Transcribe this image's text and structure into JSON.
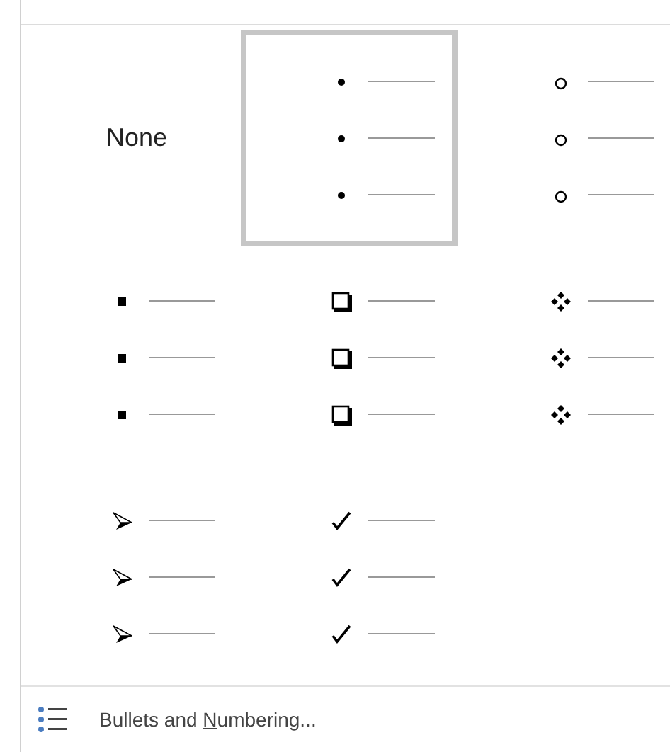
{
  "bullet_library": [
    {
      "kind": "none",
      "label": "None",
      "selected": false
    },
    {
      "kind": "disc",
      "selected": true
    },
    {
      "kind": "circle",
      "selected": false
    },
    {
      "kind": "square",
      "selected": false
    },
    {
      "kind": "box",
      "selected": false
    },
    {
      "kind": "diamonds",
      "selected": false
    },
    {
      "kind": "arrowhead",
      "selected": false
    },
    {
      "kind": "check",
      "selected": false
    }
  ],
  "footer": {
    "label_before": "Bullets and ",
    "access_key": "N",
    "label_after": "umbering..."
  }
}
